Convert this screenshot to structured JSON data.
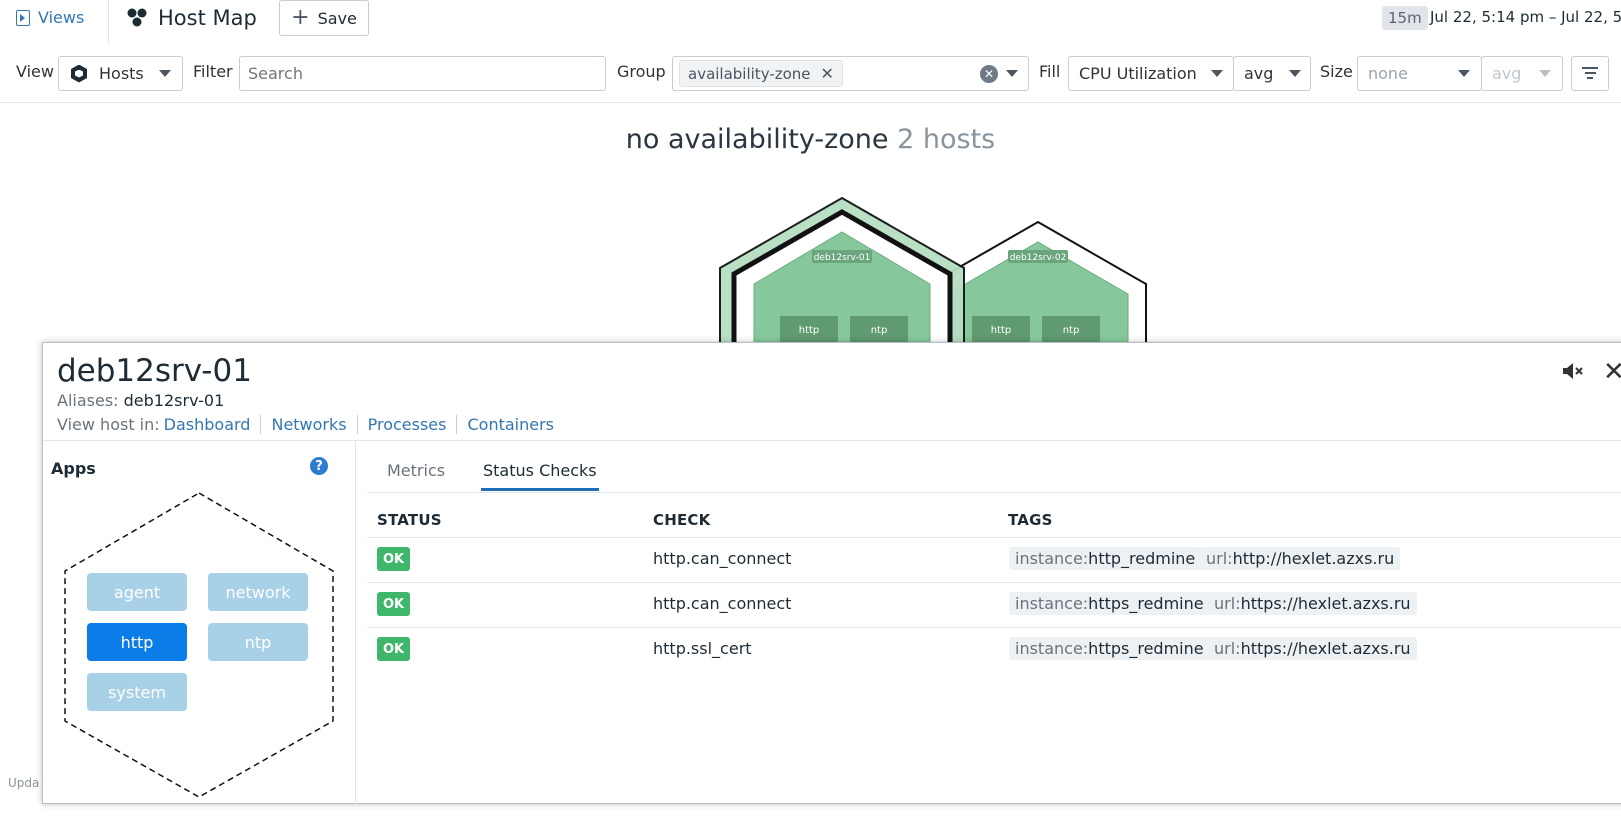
{
  "topbar": {
    "views_label": "Views",
    "title": "Host Map",
    "save_label": "Save",
    "time_badge": "15m",
    "time_range": "Jul 22, 5:14 pm – Jul 22, 5"
  },
  "filterbar": {
    "view_label": "View",
    "view_value": "Hosts",
    "filter_label": "Filter",
    "search_placeholder": "Search",
    "group_label": "Group",
    "group_tag": "availability-zone",
    "fill_label": "Fill",
    "fill_metric": "CPU Utilization",
    "fill_agg": "avg",
    "size_label": "Size",
    "size_metric": "none",
    "size_agg": "avg"
  },
  "map": {
    "group_name": "no availability-zone",
    "host_count": "2 hosts",
    "hosts": [
      {
        "name": "deb12srv-01",
        "apps": [
          "http",
          "ntp"
        ]
      },
      {
        "name": "deb12srv-02",
        "apps": [
          "http",
          "ntp"
        ]
      }
    ],
    "colors": {
      "fill_green": "#86c89b",
      "outer_green": "#b6dfc1"
    }
  },
  "panel": {
    "host_name": "deb12srv-01",
    "aliases_label": "Aliases:",
    "aliases_value": "deb12srv-01",
    "viewin_label": "View host in:",
    "links": [
      "Dashboard",
      "Networks",
      "Processes",
      "Containers"
    ],
    "apps_title": "Apps",
    "apps": [
      {
        "label": "agent",
        "selected": false
      },
      {
        "label": "network",
        "selected": false
      },
      {
        "label": "http",
        "selected": true
      },
      {
        "label": "ntp",
        "selected": false
      },
      {
        "label": "system",
        "selected": false
      }
    ],
    "tabs": [
      "Metrics",
      "Status Checks"
    ],
    "active_tab": "Status Checks",
    "table": {
      "headers": [
        "STATUS",
        "CHECK",
        "TAGS"
      ],
      "rows": [
        {
          "status": "OK",
          "check": "http.can_connect",
          "tags": [
            {
              "k": "instance:",
              "v": "http_redmine"
            },
            {
              "k": "url:",
              "v": "http://hexlet.azxs.ru"
            }
          ]
        },
        {
          "status": "OK",
          "check": "http.can_connect",
          "tags": [
            {
              "k": "instance:",
              "v": "https_redmine"
            },
            {
              "k": "url:",
              "v": "https://hexlet.azxs.ru"
            }
          ]
        },
        {
          "status": "OK",
          "check": "http.ssl_cert",
          "tags": [
            {
              "k": "instance:",
              "v": "https_redmine"
            },
            {
              "k": "url:",
              "v": "https://hexlet.azxs.ru"
            }
          ]
        }
      ]
    },
    "colors": {
      "ok": "#3fb76b",
      "link": "#3277b3",
      "app_selected": "#0b7de8",
      "app_default": "#a8d0e6"
    }
  },
  "footer": {
    "updated_text": "Upda"
  }
}
